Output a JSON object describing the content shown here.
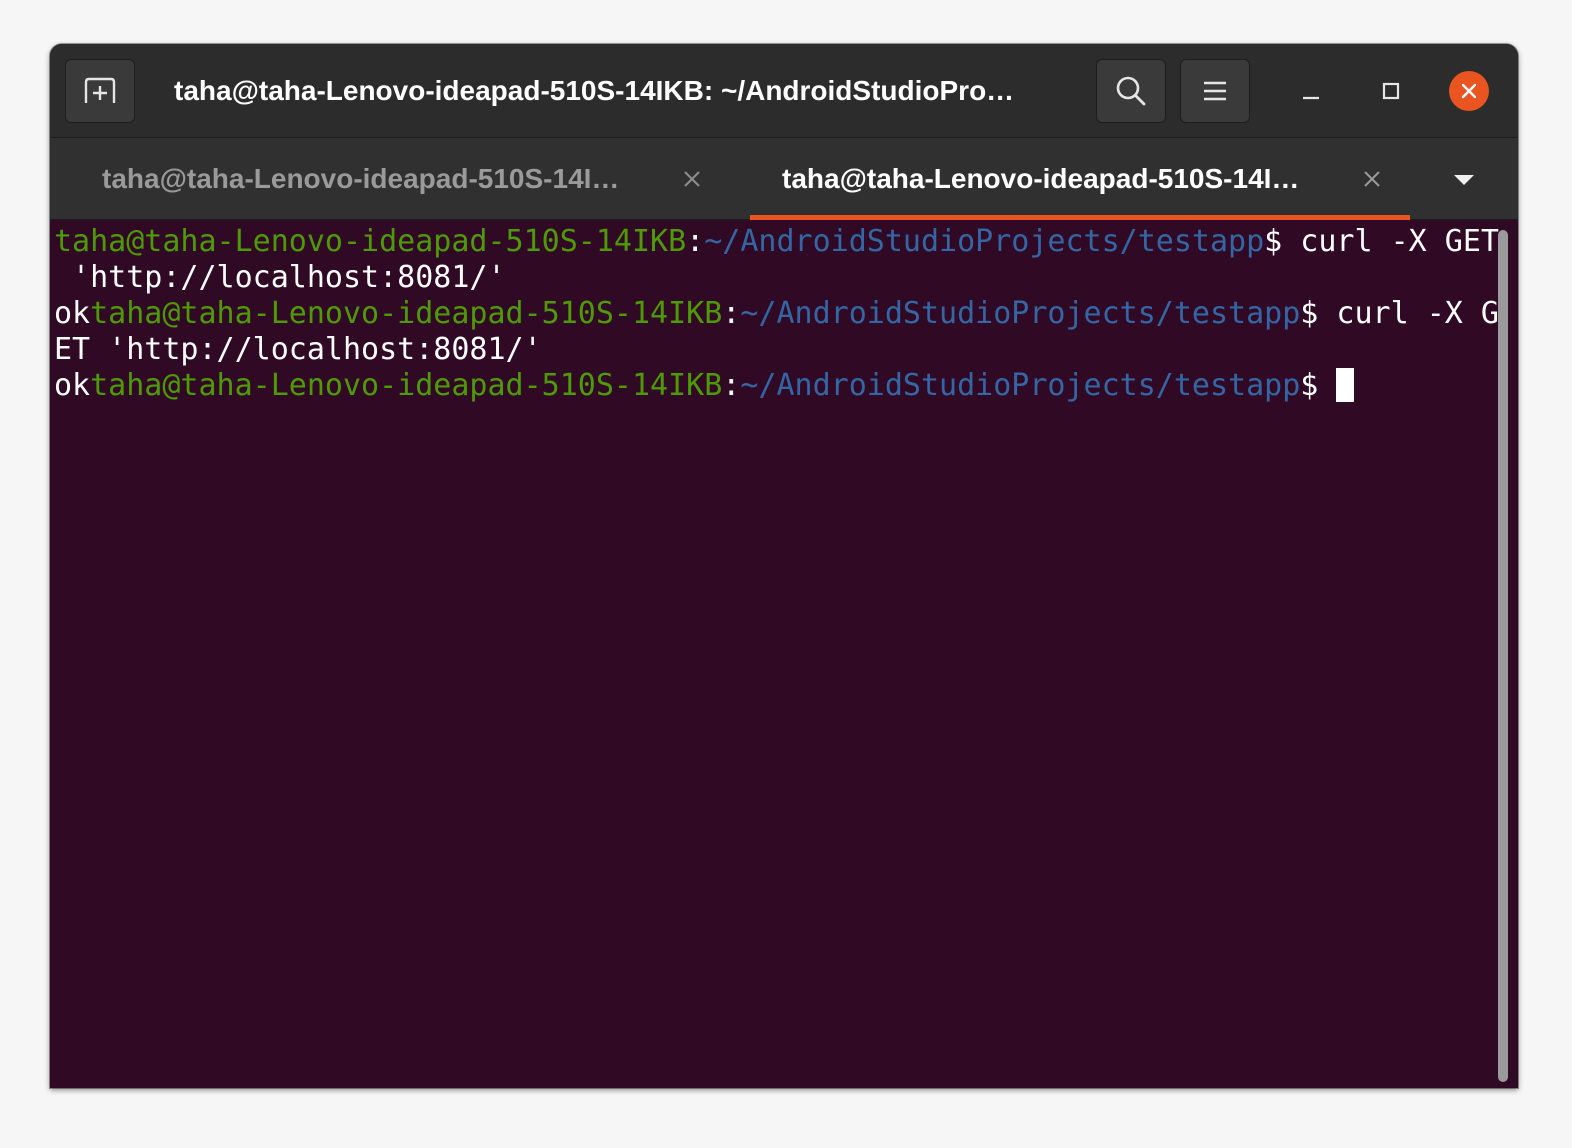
{
  "window": {
    "title": "taha@taha-Lenovo-ideapad-510S-14IKB: ~/AndroidStudioPro…"
  },
  "headerbar": {
    "new_tab_icon": "new-tab-icon",
    "search_icon": "search-icon",
    "menu_icon": "hamburger-menu-icon",
    "minimize_icon": "minimize-icon",
    "maximize_icon": "maximize-icon",
    "close_icon": "close-icon"
  },
  "tabs": [
    {
      "label": "taha@taha-Lenovo-ideapad-510S-14I…",
      "active": false
    },
    {
      "label": "taha@taha-Lenovo-ideapad-510S-14I…",
      "active": true
    }
  ],
  "terminal": {
    "lines": [
      {
        "prefix": "",
        "user": "taha@taha-Lenovo-ideapad-510S-14IKB",
        "sep": ":",
        "path": "~/AndroidStudioProjects/testapp",
        "cmd": "$ curl -X GET"
      },
      {
        "text": " 'http://localhost:8081/'"
      },
      {
        "prefix": "ok",
        "user": "taha@taha-Lenovo-ideapad-510S-14IKB",
        "sep": ":",
        "path": "~/AndroidStudioProjects/testapp",
        "cmd": "$ curl -X G"
      },
      {
        "text": "ET 'http://localhost:8081/'"
      },
      {
        "prefix": "ok",
        "user": "taha@taha-Lenovo-ideapad-510S-14IKB",
        "sep": ":",
        "path": "~/AndroidStudioProjects/testapp",
        "cmd": "$ "
      }
    ]
  },
  "colors": {
    "terminal_bg": "#300a24",
    "prompt_user": "#4e9a06",
    "prompt_path": "#3465a4",
    "accent": "#e95420",
    "headerbar_bg": "#2c2c2c"
  }
}
